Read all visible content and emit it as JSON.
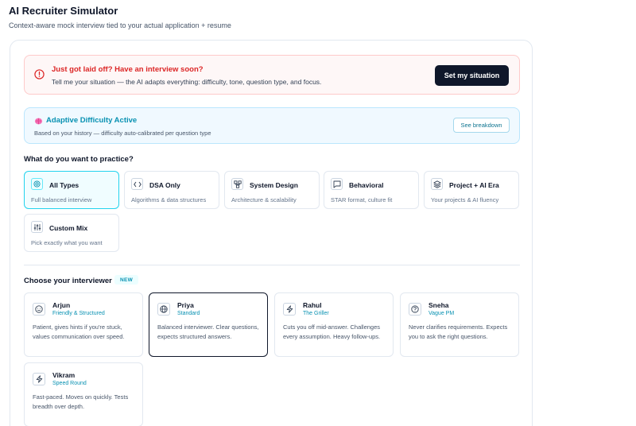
{
  "header": {
    "title": "AI Recruiter Simulator",
    "subtitle": "Context-aware mock interview tied to your actual application + resume"
  },
  "alert": {
    "icon": "alert-circle-icon",
    "title": "Just got laid off? Have an interview soon?",
    "description": "Tell me your situation — the AI adapts everything: difficulty, tone, question type, and focus.",
    "button_label": "Set my situation",
    "accent_color": "#dc2626"
  },
  "adaptive": {
    "icon": "brain-icon",
    "title": "Adaptive Difficulty Active",
    "description": "Based on your history — difficulty auto-calibrated per question type",
    "button_label": "See breakdown",
    "accent_color": "#0891b2"
  },
  "practice": {
    "heading": "What do you want to practice?",
    "selected": "All Types",
    "options": [
      {
        "label": "All Types",
        "description": "Full balanced interview",
        "icon": "target-icon"
      },
      {
        "label": "DSA Only",
        "description": "Algorithms & data structures",
        "icon": "code-icon"
      },
      {
        "label": "System Design",
        "description": "Architecture & scalability",
        "icon": "network-icon"
      },
      {
        "label": "Behavioral",
        "description": "STAR format, culture fit",
        "icon": "chat-icon"
      },
      {
        "label": "Project + AI Era",
        "description": "Your projects & AI fluency",
        "icon": "layers-icon"
      },
      {
        "label": "Custom Mix",
        "description": "Pick exactly what you want",
        "icon": "sliders-icon"
      }
    ]
  },
  "interviewers": {
    "heading": "Choose your interviewer",
    "badge": "NEW",
    "selected": "Priya",
    "items": [
      {
        "name": "Arjun",
        "style": "Friendly & Structured",
        "description": "Patient, gives hints if you're stuck, values communication over speed.",
        "icon": "smile-icon"
      },
      {
        "name": "Priya",
        "style": "Standard",
        "description": "Balanced interviewer. Clear questions, expects structured answers.",
        "icon": "globe-icon"
      },
      {
        "name": "Rahul",
        "style": "The Griller",
        "description": "Cuts you off mid-answer. Challenges every assumption. Heavy follow-ups.",
        "icon": "lightning-icon"
      },
      {
        "name": "Sneha",
        "style": "Vague PM",
        "description": "Never clarifies requirements. Expects you to ask the right questions.",
        "icon": "question-icon"
      },
      {
        "name": "Vikram",
        "style": "Speed Round",
        "description": "Fast-paced. Moves on quickly. Tests breadth over depth.",
        "icon": "lightning-icon"
      }
    ]
  }
}
